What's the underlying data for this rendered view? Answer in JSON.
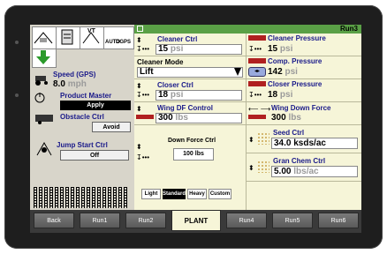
{
  "top": {
    "vt_label": "VT",
    "auto_label": "AUTO",
    "dgps_label": "DGPS"
  },
  "left": {
    "speed_label": "Speed (GPS)",
    "speed_value": "8.0",
    "speed_unit": "mph",
    "product_master_label": "Product Master",
    "product_master_button": "Apply",
    "obstacle_label": "Obstacle Ctrl",
    "obstacle_button": "Avoid",
    "jump_start_label": "Jump Start Ctrl",
    "jump_start_button": "Off"
  },
  "main": {
    "run_label": "Run3",
    "cleaner_ctrl_label": "Cleaner Ctrl",
    "cleaner_ctrl_value": "15",
    "cleaner_ctrl_unit": "psi",
    "cleaner_pressure_label": "Cleaner Pressure",
    "cleaner_pressure_value": "15",
    "cleaner_pressure_unit": "psi",
    "cleaner_mode_label": "Cleaner Mode",
    "cleaner_mode_value": "Lift",
    "comp_pressure_label": "Comp. Pressure",
    "comp_pressure_value": "142",
    "comp_pressure_unit": "psi",
    "closer_ctrl_label": "Closer Ctrl",
    "closer_ctrl_value": "18",
    "closer_ctrl_unit": "psi",
    "closer_pressure_label": "Closer Pressure",
    "closer_pressure_value": "18",
    "closer_pressure_unit": "psi",
    "wing_df_label": "Wing DF Control",
    "wing_df_value": "300",
    "wing_df_unit": "lbs",
    "wing_down_label": "Wing Down Force",
    "wing_down_value": "300",
    "wing_down_unit": "lbs",
    "down_force_label": "Down Force Ctrl",
    "down_force_value": "100 lbs",
    "seed_ctrl_label": "Seed Ctrl",
    "seed_ctrl_value": "34.0",
    "seed_ctrl_unit": "ksds/ac",
    "gran_chem_label": "Gran Chem Ctrl",
    "gran_chem_value": "5.00",
    "gran_chem_unit": "lbs/ac",
    "df_modes": [
      "Light",
      "Standard",
      "Heavy",
      "Custom"
    ],
    "df_mode_selected": "Standard"
  },
  "tabs": [
    "Back",
    "Run1",
    "Run2",
    "PLANT",
    "Run4",
    "Run5",
    "Run6"
  ],
  "active_tab": "PLANT",
  "colors": {
    "label_blue": "#1a1a8a",
    "title_green": "#5aa046",
    "panel_yellow": "#f6f5d8"
  }
}
